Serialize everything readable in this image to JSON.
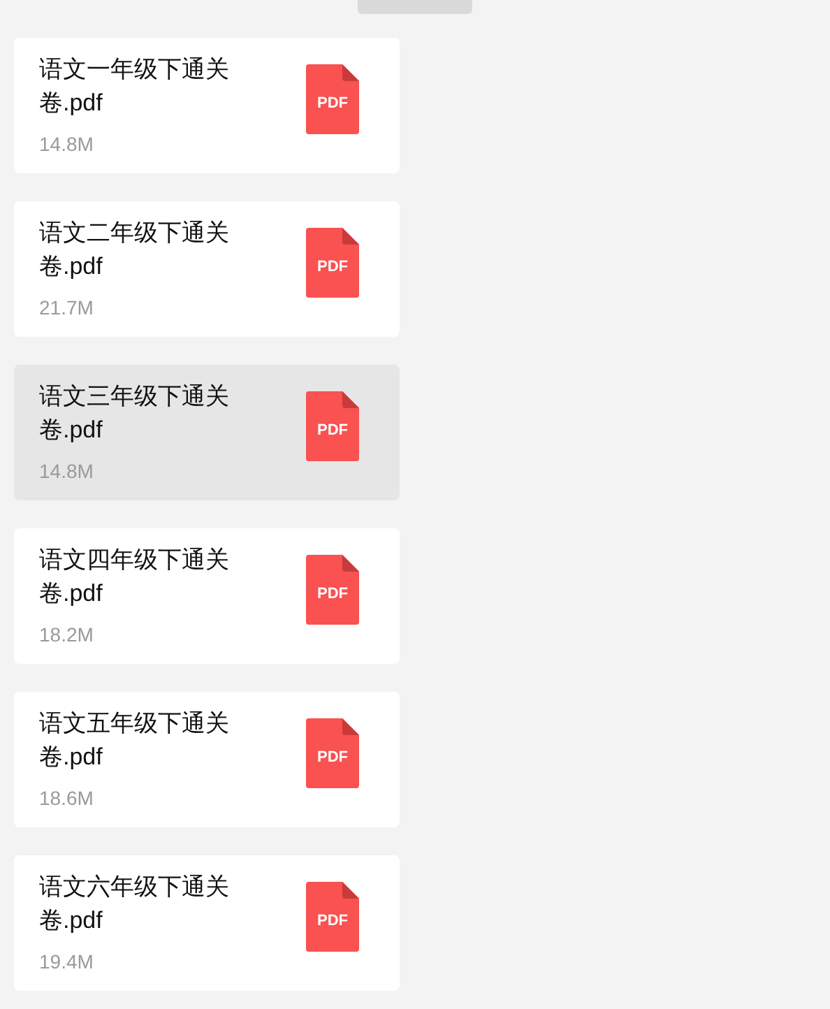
{
  "messages": [
    {
      "name": "语文一年级下通关卷.pdf",
      "size": "14.8M",
      "icon_label": "PDF",
      "selected": false
    },
    {
      "name": "语文二年级下通关卷.pdf",
      "size": "21.7M",
      "icon_label": "PDF",
      "selected": false
    },
    {
      "name": "语文三年级下通关卷.pdf",
      "size": "14.8M",
      "icon_label": "PDF",
      "selected": true
    },
    {
      "name": "语文四年级下通关卷.pdf",
      "size": "18.2M",
      "icon_label": "PDF",
      "selected": false
    },
    {
      "name": "语文五年级下通关卷.pdf",
      "size": "18.6M",
      "icon_label": "PDF",
      "selected": false
    },
    {
      "name": "语文六年级下通关卷.pdf",
      "size": "19.4M",
      "icon_label": "PDF",
      "selected": false
    }
  ]
}
